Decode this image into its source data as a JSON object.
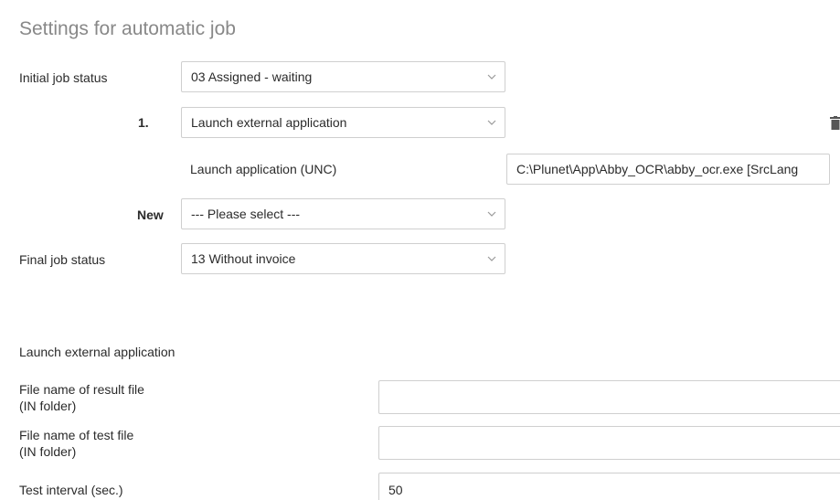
{
  "section_title": "Settings for automatic job",
  "initial_status": {
    "label": "Initial job status",
    "value": "03 Assigned - waiting"
  },
  "step1": {
    "number": "1.",
    "action_value": "Launch external application",
    "app_label": "Launch application (UNC)",
    "app_value": "C:\\Plunet\\App\\Abby_OCR\\abby_ocr.exe [SrcLang"
  },
  "new_step": {
    "label": "New",
    "value": "--- Please select ---"
  },
  "final_status": {
    "label": "Final job status",
    "value": "13 Without invoice"
  },
  "launch_section": {
    "heading": "Launch external application",
    "result_file_label_line1": "File name of result file",
    "result_file_label_line2": "(IN folder)",
    "result_file_value": "",
    "test_file_label_line1": "File name of test file",
    "test_file_label_line2": "(IN folder)",
    "test_file_value": "",
    "interval_label": "Test interval (sec.)",
    "interval_value": "50"
  },
  "icons": {
    "chevron": "chevron-down-icon",
    "trash": "trash-icon"
  },
  "colors": {
    "title": "#888888",
    "border": "#cfcfcf",
    "text": "#2b2b2b"
  }
}
